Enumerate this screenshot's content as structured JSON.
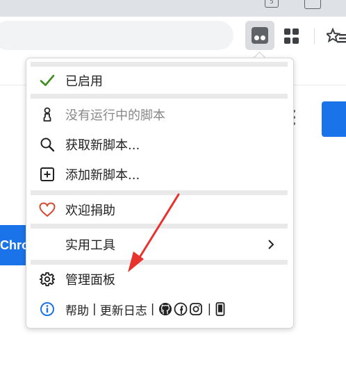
{
  "browser": {
    "tab_count": "5",
    "colors": {
      "tabstrip": "#dee1e6",
      "omnibox": "#f1f3f4",
      "accent": "#1a73e8"
    },
    "icons": [
      "tampermonkey-extension-icon",
      "extensions-grid-icon",
      "reading-list-icon"
    ]
  },
  "page": {
    "left_button_text": "Chro"
  },
  "menu": {
    "enabled_label": "已启用",
    "no_scripts_label": "没有运行中的脚本",
    "get_scripts_label": "获取新脚本...",
    "add_script_label": "添加新脚本...",
    "donate_label": "欢迎捐助",
    "utilities_label": "实用工具",
    "dashboard_label": "管理面板",
    "help_label": "帮助",
    "separator": "|",
    "changelog_label": "更新日志",
    "colors": {
      "check": "#3d8b1f",
      "heart": "#d24a2f",
      "info": "#1a73e8",
      "separator_bar": "#e9e9e9"
    }
  },
  "annotation": {
    "arrow_color": "#e8322e",
    "points_to": "dashboard"
  }
}
